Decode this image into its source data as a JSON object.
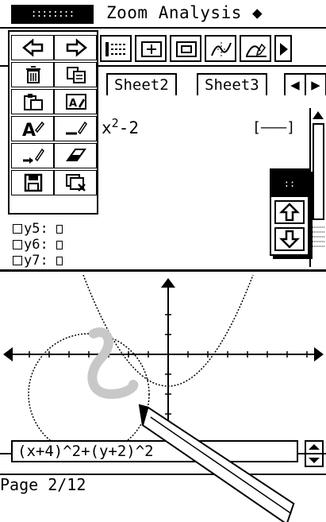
{
  "menubar": {
    "dots_label": "::::::::",
    "title": "Zoom Analysis ◆"
  },
  "palette": {
    "items": [
      "back-arrow-icon",
      "forward-arrow-icon",
      "trash-icon",
      "copy-icon",
      "paste-icon",
      "format-icon",
      "text-style-icon",
      "pen-line-icon",
      "arrow-pen-icon",
      "eraser-icon",
      "save-icon",
      "clear-icon"
    ]
  },
  "tabs": {
    "sheet2": "Sheet2",
    "sheet3": "Sheet3",
    "left": "◀",
    "right": "▶"
  },
  "editor": {
    "expr_base": "x",
    "expr_exp": "2",
    "expr_rest": "-2",
    "bracket": "[———]",
    "rows": [
      {
        "label": "y5:"
      },
      {
        "label": "y6:"
      },
      {
        "label": "y7:"
      }
    ]
  },
  "right_popup": {
    "hdr": "::",
    "up": "⇧",
    "down": "⇩"
  },
  "inputline": {
    "value": "(x+4)^2+(y+2)^2"
  },
  "status": {
    "page": "Page 2/12"
  }
}
